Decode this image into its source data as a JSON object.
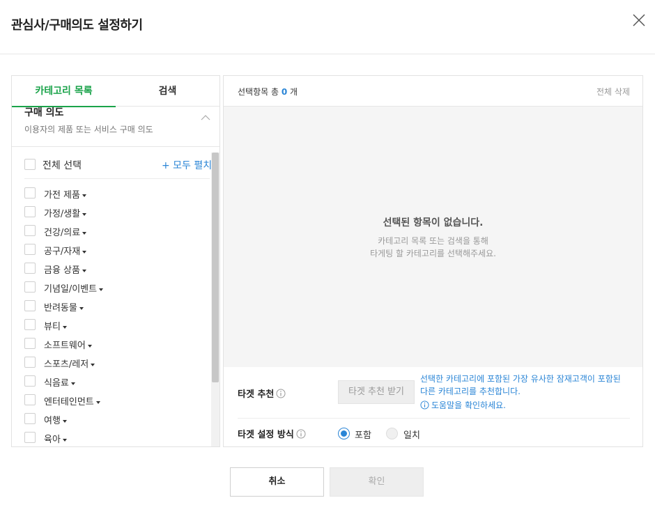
{
  "dialog": {
    "title": "관심사/구매의도 설정하기"
  },
  "tabs": [
    {
      "label": "카테고리 목록"
    },
    {
      "label": "검색"
    }
  ],
  "section": {
    "title": "구매 의도",
    "description": "이용자의 제품 또는 서비스 구매 의도"
  },
  "select_all": {
    "label": "전체 선택",
    "expand_all": "+ 모두 펼치기"
  },
  "categories": [
    {
      "label": "가전 제품"
    },
    {
      "label": "가정/생활"
    },
    {
      "label": "건강/의료"
    },
    {
      "label": "공구/자재"
    },
    {
      "label": "금융 상품"
    },
    {
      "label": "기념일/이벤트"
    },
    {
      "label": "반려동물"
    },
    {
      "label": "뷰티"
    },
    {
      "label": "소프트웨어"
    },
    {
      "label": "스포츠/레저"
    },
    {
      "label": "식음료"
    },
    {
      "label": "엔터테인먼트"
    },
    {
      "label": "여행"
    },
    {
      "label": "육아"
    }
  ],
  "selection": {
    "count_prefix": "선택항목 총 ",
    "count": "0",
    "count_suffix": " 개",
    "delete_all": "전체 삭제",
    "empty_title": "선택된 항목이 없습니다.",
    "empty_line1": "카테고리 목록 또는 검색을 통해",
    "empty_line2": "타게팅 할 카테고리를 선택해주세요."
  },
  "recommend": {
    "label": "타겟 추천",
    "button": "타겟 추천 받기",
    "description": "선택한 카테고리에 포함된 가장 유사한 잠재고객이 포함된 다른 카테고리를 추천합니다.",
    "help": "도움말을 확인하세요."
  },
  "method": {
    "label": "타겟 설정 방식",
    "option_include": "포함",
    "option_match": "일치"
  },
  "footer": {
    "cancel": "취소",
    "confirm": "확인"
  },
  "colors": {
    "accent_green": "#1aa34a",
    "accent_blue": "#2a85d6"
  }
}
